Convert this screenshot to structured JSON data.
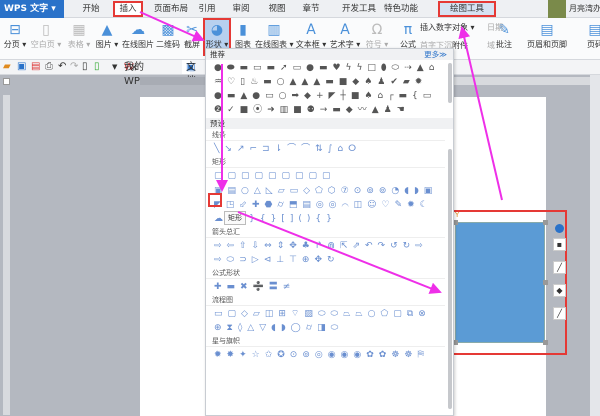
{
  "app": {
    "logo": "WPS 文字"
  },
  "tabs": [
    "开始",
    "插入",
    "页面布局",
    "引用",
    "审阅",
    "视图",
    "章节",
    "开发工具",
    "特色功能",
    "绘图工具"
  ],
  "user": "月亮湾办...",
  "ribbon": {
    "big": [
      {
        "label": "分页 ▾",
        "icon": "⊟"
      },
      {
        "label": "空白页 ▾",
        "icon": "▯",
        "gray": true
      },
      {
        "label": "表格 ▾",
        "icon": "▦",
        "gray": true
      },
      {
        "label": "图片 ▾",
        "icon": "▲"
      },
      {
        "label": "在线图片",
        "icon": "☁"
      },
      {
        "label": "二维码",
        "icon": "▩"
      },
      {
        "label": "截屏",
        "icon": "✂"
      },
      {
        "label": "形状 ▾",
        "icon": "◕"
      },
      {
        "label": "图表",
        "icon": "▮"
      },
      {
        "label": "在线图表 ▾",
        "icon": "▥"
      },
      {
        "label": "文本框 ▾",
        "icon": "A"
      },
      {
        "label": "艺术字 ▾",
        "icon": "A"
      },
      {
        "label": "符号 ▾",
        "icon": "Ω",
        "gray": true
      },
      {
        "label": "公式",
        "icon": "π"
      },
      {
        "label": "批注",
        "icon": "✎"
      },
      {
        "label": "页眉和页脚",
        "icon": "▤"
      },
      {
        "label": "页码",
        "icon": "▤"
      }
    ],
    "small": [
      {
        "label": "插入数字"
      },
      {
        "label": "对象 ▾"
      },
      {
        "label": "日期",
        "gray": true
      },
      {
        "label": "首字下沉",
        "gray": true
      },
      {
        "label": "附件"
      },
      {
        "label": "域",
        "gray": true
      }
    ]
  },
  "quick": {
    "doc_tabs": [
      "我的WPS",
      "文档"
    ]
  },
  "panel": {
    "recommended": "推荐",
    "more": "更多≫",
    "preset": "预设",
    "rec_icons": "●⬬▬▭▬➚▭●▬♥ϟϟ□⬮⬭⇢▲⌂♒♡▯♨▬○▲▲▲▬■◆♠♟✔▰✹●▬▲●▭○➡◆+◤┼■♠⌂┌▬{▭❷✓■⦿➜▥■⚉→▬◆〰▲♟☚",
    "sections": [
      {
        "title": "线条",
        "icons": "╲↘↗⌐⊐⇂⌒⌒⇅∫⌂ⵔ"
      },
      {
        "title": "矩形",
        "icons": "▢▢▢▢▢▢▢▢▢"
      },
      {
        "title": "",
        "icons": "▣▤○△◺▱▭◇⬠⬡⑦⊙⊚⊚◔◖◗▣◤◳⬃✚⬣⌭⬒▤◎◎⌒◫☺♡✎✹☾☁╮{}{}[](){}"
      },
      {
        "title": "箭头总汇",
        "icons": "⇨⇦⇧⇩⇔⇕✥♣↱⋒⇱⇗↶↷↺↻⇨⇨⬭⊃▷⊲⊥⊤⊕✥↻"
      },
      {
        "title": "公式形状",
        "icons": "✚▬✖➗〓≠"
      },
      {
        "title": "流程图",
        "icons": "▭▢◇▱◫⊞⌔▨⬭⬭⏢⏢○⬠▢⧉⊗⊕⧗◊△▽◖◗◯⌭◨⬭"
      },
      {
        "title": "星与旗帜",
        "icons": "✹✸✦☆✩✪⊙⊚◎◉◉◉✿✿☸☸⛿"
      }
    ],
    "tooltip": "矩形"
  },
  "colors": {
    "accent": "#2a72c9",
    "highlight": "#e53935",
    "arrow": "#ee2fe8",
    "shape_fill": "#5b9bd5"
  }
}
